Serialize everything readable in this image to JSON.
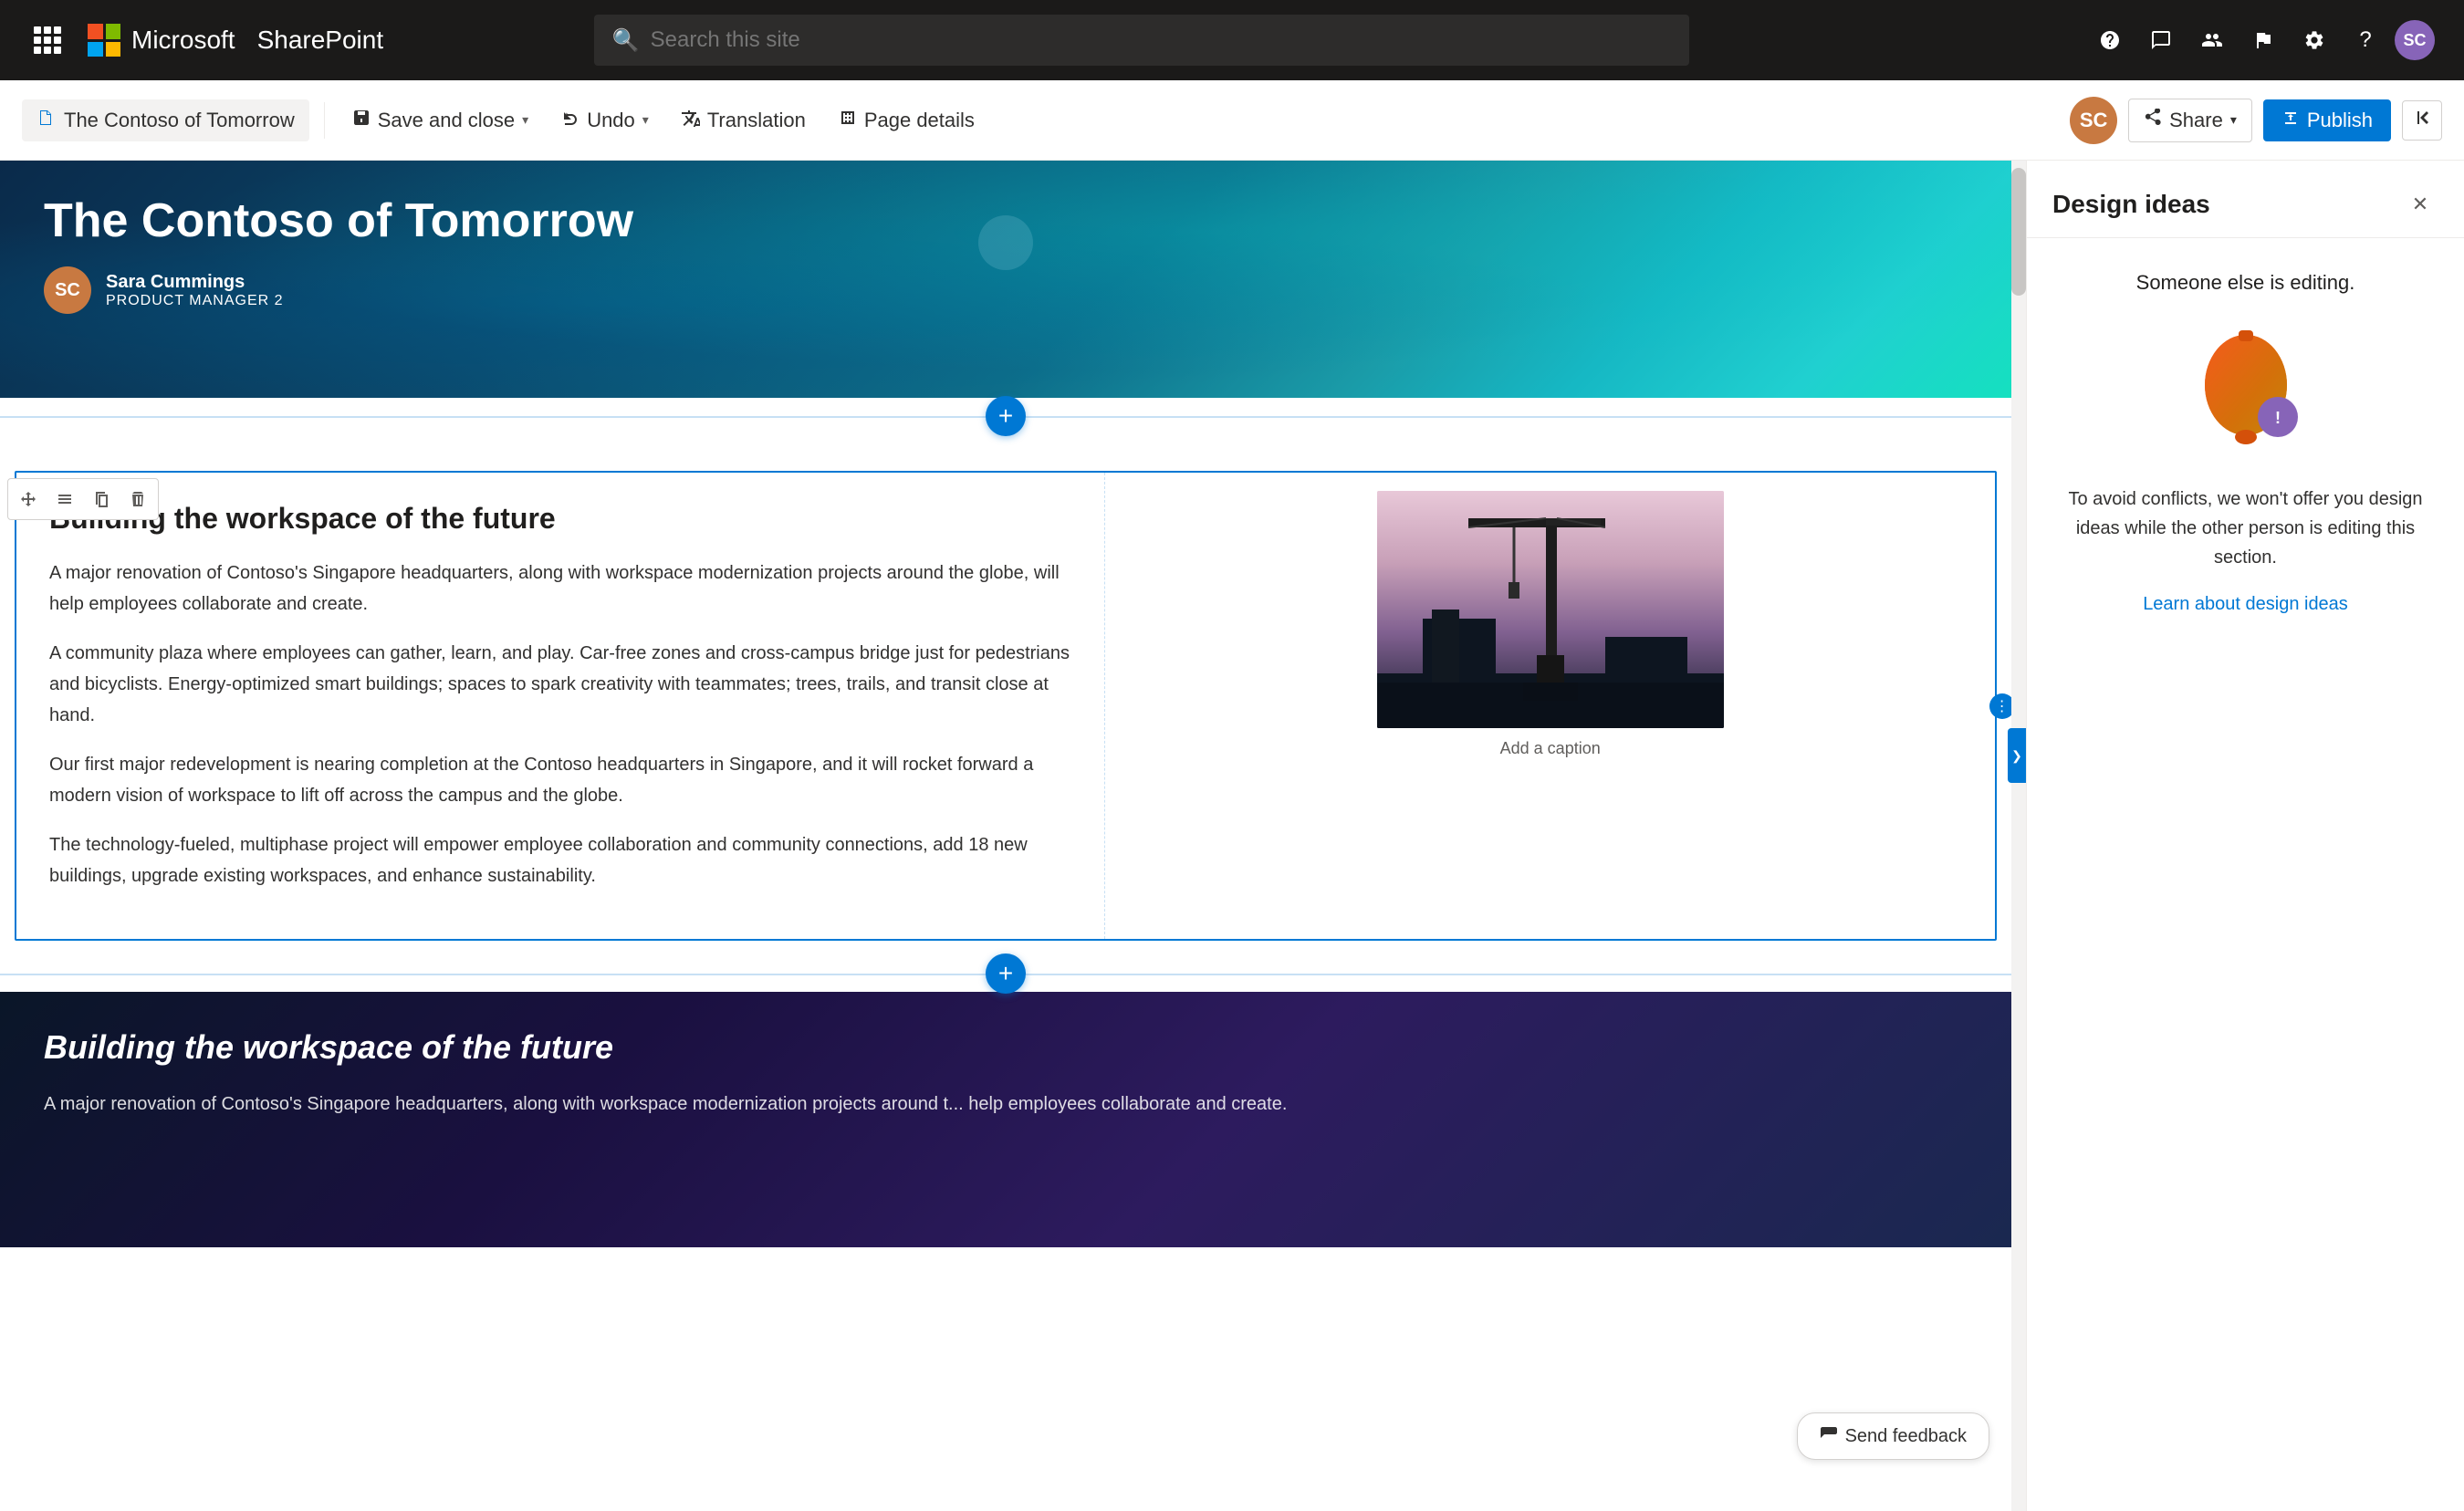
{
  "topnav": {
    "app_name": "Microsoft",
    "product": "SharePoint",
    "search_placeholder": "Search this site"
  },
  "toolbar": {
    "page_tab_label": "The Contoso of Tomorrow",
    "save_close_label": "Save and close",
    "undo_label": "Undo",
    "translation_label": "Translation",
    "page_details_label": "Page details",
    "share_label": "Share",
    "publish_label": "Publish"
  },
  "hero": {
    "title": "The Contoso of Tomorrow",
    "author_name": "Sara Cummings",
    "author_role": "PRODUCT MANAGER 2"
  },
  "article": {
    "heading": "Building the workspace of the future",
    "para1": "A major renovation of Contoso's Singapore headquarters, along with workspace modernization projects around the globe, will help employees collaborate and create.",
    "para2": "A community plaza where employees can gather, learn, and play. Car-free zones and cross-campus bridge just for pedestrians and bicyclists. Energy-optimized smart buildings; spaces to spark creativity with teammates; trees, trails, and transit close at hand.",
    "para3": "Our first major redevelopment is nearing completion at the Contoso headquarters in Singapore, and it will rocket forward a modern vision of workspace to lift off across the campus and the globe.",
    "para4": "The technology-fueled, multiphase project will empower employee collaboration and community connections, add 18 new buildings, upgrade existing workspaces, and enhance sustainability.",
    "image_caption": "Add a caption"
  },
  "dark_section": {
    "heading": "Building the workspace of the future",
    "para": "A major renovation of Contoso's Singapore headquarters, along with workspace modernization projects around t... help employees collaborate and create."
  },
  "design_panel": {
    "title": "Design ideas",
    "editing_notice": "Someone else is editing.",
    "description": "To avoid conflicts, we won't offer you design ideas while the other person is editing this section.",
    "learn_link": "Learn about design ideas"
  },
  "feedback": {
    "label": "Send feedback"
  },
  "icons": {
    "waffle": "⊞",
    "search": "🔍",
    "bell": "🔔",
    "chat": "💬",
    "people": "👥",
    "flag": "⚑",
    "gear": "⚙",
    "help": "?",
    "page": "📄",
    "save": "💾",
    "undo": "↩",
    "translate": "🌐",
    "settings_page": "⚙",
    "share_icon": "↗",
    "publish_icon": "📋",
    "close": "✕",
    "move": "⤡",
    "adjust": "≡",
    "copy": "⧉",
    "delete": "🗑",
    "add": "+",
    "chevron": "›",
    "collapse": "⤢",
    "handle": "·",
    "feedback_icon": "✏"
  }
}
